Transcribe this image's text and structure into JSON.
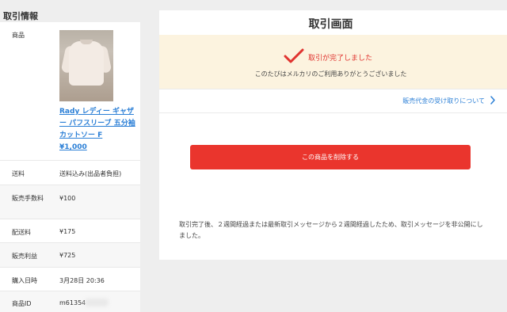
{
  "sidebar": {
    "title": "取引情報",
    "product": {
      "label": "商品",
      "name": "Rady レディー ギャザー パフスリーブ 五分袖 カットソー F",
      "price": "¥1,000"
    },
    "rows": [
      {
        "label": "送料",
        "value": "送料込み(出品者負担)"
      },
      {
        "label": "販売手数料",
        "value": "¥100"
      },
      {
        "label": "配送料",
        "value": "¥175"
      },
      {
        "label": "販売利益",
        "value": "¥725"
      },
      {
        "label": "購入日時",
        "value": "3月28日 20:36"
      },
      {
        "label": "商品ID",
        "value": "m61354"
      }
    ]
  },
  "main": {
    "title": "取引画面",
    "complete_title": "取引が完了しました",
    "complete_sub": "このたびはメルカリのご利用ありがとうございました",
    "receipt_link": "販売代金の受け取りについて",
    "delete_button": "この商品を削除する",
    "notice": "取引完了後、２週間経過または最新取引メッセージから２週間経過したため、取引メッセージを非公開にしました。"
  },
  "colors": {
    "accent_red": "#ea352d",
    "link_blue": "#2b7fd6",
    "banner_bg": "#fcf3df"
  },
  "icons": {
    "check": "check-icon",
    "chevron": "chevron-right-icon"
  }
}
